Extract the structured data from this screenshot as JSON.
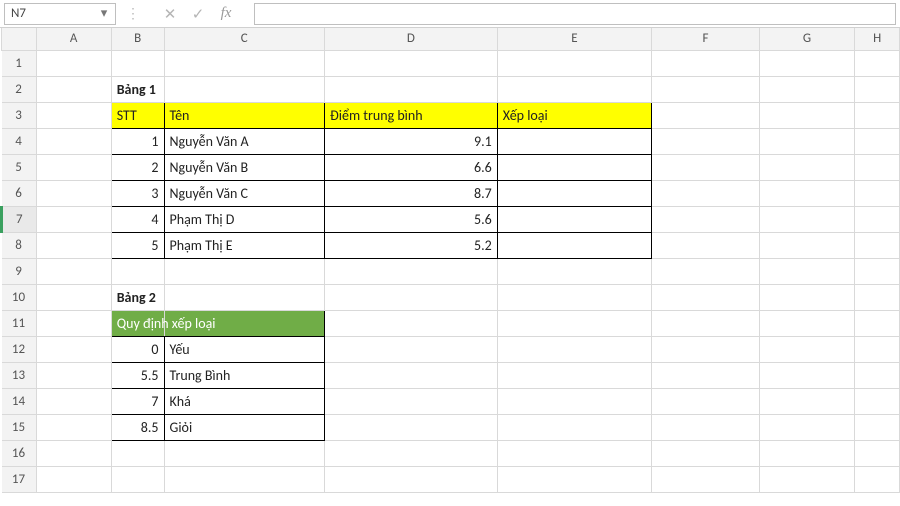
{
  "namebox": {
    "value": "N7"
  },
  "fx": {
    "cancel": "✕",
    "accept": "✓",
    "label": "fx"
  },
  "cols": [
    "A",
    "B",
    "C",
    "D",
    "E",
    "F",
    "G",
    "H"
  ],
  "rows": [
    "1",
    "2",
    "3",
    "4",
    "5",
    "6",
    "7",
    "8",
    "9",
    "10",
    "11",
    "12",
    "13",
    "14",
    "15",
    "16",
    "17"
  ],
  "selected_row_index": 6,
  "table1": {
    "title": "Bảng 1",
    "headers": {
      "stt": "STT",
      "ten": "Tên",
      "dtb": "Điểm trung bình",
      "xl": "Xếp loại"
    },
    "rows": [
      {
        "stt": "1",
        "ten": "Nguyễn Văn A",
        "dtb": "9.1",
        "xl": ""
      },
      {
        "stt": "2",
        "ten": "Nguyễn Văn B",
        "dtb": "6.6",
        "xl": ""
      },
      {
        "stt": "3",
        "ten": "Nguyễn Văn C",
        "dtb": "8.7",
        "xl": ""
      },
      {
        "stt": "4",
        "ten": "Phạm Thị D",
        "dtb": "5.6",
        "xl": ""
      },
      {
        "stt": "5",
        "ten": "Phạm Thị E",
        "dtb": "5.2",
        "xl": ""
      }
    ]
  },
  "table2": {
    "title": "Bảng 2",
    "header": "Quy định xếp loại",
    "rows": [
      {
        "v": "0",
        "label": "Yếu"
      },
      {
        "v": "5.5",
        "label": "Trung Bình"
      },
      {
        "v": "7",
        "label": "Khá"
      },
      {
        "v": "8.5",
        "label": "Giỏi"
      }
    ]
  }
}
